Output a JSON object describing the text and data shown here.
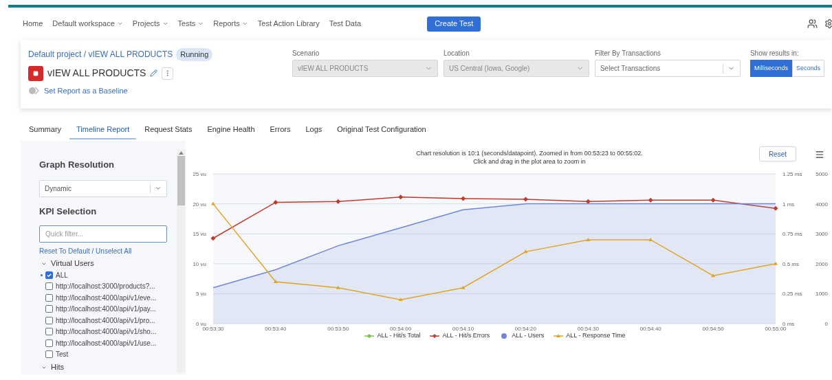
{
  "nav": {
    "items": [
      {
        "label": "Home",
        "dropdown": false
      },
      {
        "label": "Default workspace",
        "dropdown": true
      },
      {
        "label": "Projects",
        "dropdown": true
      },
      {
        "label": "Tests",
        "dropdown": true
      },
      {
        "label": "Reports",
        "dropdown": true
      },
      {
        "label": "Test Action Library",
        "dropdown": false
      },
      {
        "label": "Test Data",
        "dropdown": false
      }
    ],
    "create_button": "Create Test"
  },
  "header": {
    "breadcrumb": "Default project / vIEW ALL PRODUCTS",
    "status": "Running",
    "title": "vIEW ALL PRODUCTS",
    "baseline_link": "Set Report as a Baseline",
    "filters": [
      {
        "label": "Scenario",
        "value": "vIEW ALL PRODUCTS",
        "disabled": true
      },
      {
        "label": "Location",
        "value": "US Central (Iowa, Google)",
        "disabled": true
      },
      {
        "label": "Filter By Transactions",
        "placeholder": "Select Transactions",
        "disabled": false
      }
    ],
    "units": {
      "label": "Show results in:",
      "options": [
        {
          "label": "Milliseconds",
          "selected": true
        },
        {
          "label": "Seconds",
          "selected": false
        }
      ]
    }
  },
  "tabs": [
    {
      "label": "Summary",
      "selected": false
    },
    {
      "label": "Timeline Report",
      "selected": true
    },
    {
      "label": "Request Stats",
      "selected": false
    },
    {
      "label": "Engine Health",
      "selected": false
    },
    {
      "label": "Errors",
      "selected": false
    },
    {
      "label": "Logs",
      "selected": false
    },
    {
      "label": "Original Test Configuration",
      "selected": false
    }
  ],
  "sidebar": {
    "resolution_title": "Graph Resolution",
    "resolution_value": "Dynamic",
    "kpi_title": "KPI Selection",
    "filter_placeholder": "Quick filter...",
    "reset_link": "Reset To Default",
    "separator": "/",
    "unselect_link": "Unselect All",
    "groups": [
      {
        "label": "Virtual Users",
        "expanded": true,
        "children": [
          {
            "label": "ALL",
            "checked": true
          },
          {
            "label": "http://localhost:3000/products?...",
            "checked": false
          },
          {
            "label": "http://localhost:4000/api/v1/eve...",
            "checked": false
          },
          {
            "label": "http://localhost:4000/api/v1/pay...",
            "checked": false
          },
          {
            "label": "http://localhost:4000/api/v1/pro...",
            "checked": false
          },
          {
            "label": "http://localhost:4000/api/v1/sho...",
            "checked": false
          },
          {
            "label": "http://localhost:4000/api/v1/use...",
            "checked": false
          },
          {
            "label": "Test",
            "checked": false
          }
        ]
      },
      {
        "label": "Hits",
        "expanded": true
      }
    ]
  },
  "chart": {
    "caption_lines": [
      "Chart resolution is 10:1 (seconds/datapoint). Zoomed in from 00:53:23 to 00:55:02.",
      "Click and drag in the plot area to zoom in"
    ],
    "reset_button": "Reset",
    "chart_data": {
      "type": "line",
      "categories": [
        "00:53:30",
        "00:53:40",
        "00:53:50",
        "00:54:00",
        "00:54:10",
        "00:54:20",
        "00:54:30",
        "00:54:40",
        "00:54:50",
        "00:55:00"
      ],
      "ylim": [
        0,
        25
      ],
      "yticks": [
        {
          "value": 0,
          "label": "0 vu"
        },
        {
          "value": 5,
          "label": "5 vu"
        },
        {
          "value": 10,
          "label": "10 vu"
        },
        {
          "value": 15,
          "label": "15 vu"
        },
        {
          "value": 20,
          "label": "20 vu"
        },
        {
          "value": 25,
          "label": "25 vu"
        }
      ],
      "grid": true,
      "y2lim": [
        0,
        1.25
      ],
      "y2ticks": [
        {
          "value": 1.25,
          "label": "1.25 ms"
        },
        {
          "value": 1,
          "label": "1 ms"
        },
        {
          "value": 0.75,
          "label": "0.75 ms"
        },
        {
          "value": 0.5,
          "label": "0.5 ms"
        },
        {
          "value": 0.25,
          "label": "0.25 ms"
        },
        {
          "value": 0,
          "label": "0 ms"
        }
      ],
      "y3lim": [
        0,
        5000
      ],
      "y3ticks": [
        5000,
        4000,
        3000,
        2000,
        1000,
        0
      ],
      "series": [
        {
          "name": "ALL - Hit/s Total",
          "color": "#7cc142",
          "marker": "circle",
          "values": [
            null,
            null,
            null,
            null,
            null,
            null,
            null,
            null,
            null,
            null
          ]
        },
        {
          "name": "ALL - Hit/s Errors",
          "color": "#c0392b",
          "axis": "y3",
          "marker": "diamond",
          "values": [
            2850,
            4050,
            4075,
            4225,
            4175,
            4150,
            4075,
            4125,
            4125,
            3850
          ]
        },
        {
          "name": "ALL - Users",
          "color": "#6f86d6",
          "type": "area",
          "values": [
            6,
            9,
            13,
            16,
            19,
            20,
            20,
            20,
            20,
            20
          ]
        },
        {
          "name": "ALL - Response Time",
          "color": "#e0a526",
          "axis": "y2",
          "marker": "triangle",
          "values": [
            1.0,
            0.35,
            0.3,
            0.2,
            0.3,
            0.6,
            0.7,
            0.7,
            0.4,
            0.5
          ]
        }
      ]
    }
  }
}
